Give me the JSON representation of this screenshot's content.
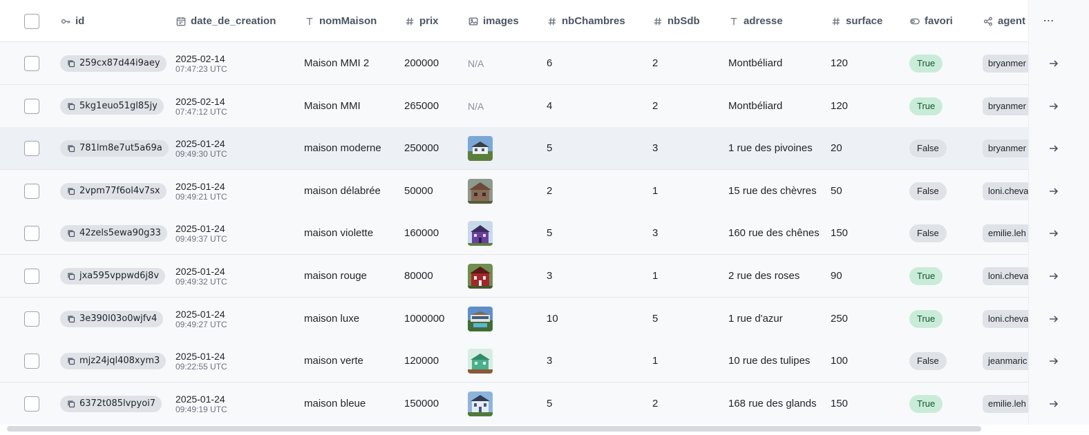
{
  "columns": {
    "id": "id",
    "date_de_creation": "date_de_creation",
    "nomMaison": "nomMaison",
    "prix": "prix",
    "images": "images",
    "nbChambres": "nbChambres",
    "nbSdb": "nbSdb",
    "adresse": "adresse",
    "surface": "surface",
    "favori": "favori",
    "agent": "agent",
    "more": "⋯"
  },
  "icons": {
    "id": "key-icon",
    "date_de_creation": "calendar-icon",
    "nomMaison": "text-icon",
    "prix": "hash-icon",
    "images": "image-icon",
    "nbChambres": "hash-icon",
    "nbSdb": "hash-icon",
    "adresse": "text-icon",
    "surface": "hash-icon",
    "favori": "toggle-icon",
    "agent": "relation-icon"
  },
  "colors": {
    "true_badge_bg": "#c9ecd8",
    "false_badge_bg": "#dfe2e7",
    "pill_bg": "#dfe2e7",
    "row_hover_bg": "#edf0f4"
  },
  "rows": [
    {
      "id": "259cx87d44i9aey",
      "date": "2025-02-14",
      "time": "07:47:23 UTC",
      "nomMaison": "Maison MMI 2",
      "prix": "200000",
      "image": "N/A",
      "nbChambres": "6",
      "nbSdb": "2",
      "adresse": "Montbéliard",
      "surface": "120",
      "favori": "True",
      "agent": "bryanmer"
    },
    {
      "id": "5kg1euo51gl85jy",
      "date": "2025-02-14",
      "time": "07:47:12 UTC",
      "nomMaison": "Maison MMI",
      "prix": "265000",
      "image": "N/A",
      "nbChambres": "4",
      "nbSdb": "2",
      "adresse": "Montbéliard",
      "surface": "120",
      "favori": "True",
      "agent": "bryanmer"
    },
    {
      "id": "781lm8e7ut5a69a",
      "date": "2025-01-24",
      "time": "09:49:30 UTC",
      "nomMaison": "maison moderne",
      "prix": "250000",
      "image": "white-house",
      "nbChambres": "5",
      "nbSdb": "3",
      "adresse": "1 rue des pivoines",
      "surface": "20",
      "favori": "False",
      "agent": "bryanmer"
    },
    {
      "id": "2vpm77f6ol4v7sx",
      "date": "2025-01-24",
      "time": "09:49:21 UTC",
      "nomMaison": "maison délabrée",
      "prix": "50000",
      "image": "old-house",
      "nbChambres": "2",
      "nbSdb": "1",
      "adresse": "15 rue des chèvres",
      "surface": "50",
      "favori": "False",
      "agent": "loni.cheva"
    },
    {
      "id": "42zels5ewa90g33",
      "date": "2025-01-24",
      "time": "09:49:37 UTC",
      "nomMaison": "maison violette",
      "prix": "160000",
      "image": "purple-house",
      "nbChambres": "5",
      "nbSdb": "3",
      "adresse": "160 rue des chênes",
      "surface": "150",
      "favori": "False",
      "agent": "emilie.leh"
    },
    {
      "id": "jxa595vppwd6j8v",
      "date": "2025-01-24",
      "time": "09:49:32 UTC",
      "nomMaison": "maison rouge",
      "prix": "80000",
      "image": "red-house",
      "nbChambres": "3",
      "nbSdb": "1",
      "adresse": "2 rue des roses",
      "surface": "90",
      "favori": "True",
      "agent": "loni.cheva"
    },
    {
      "id": "3e390l03o0wjfv4",
      "date": "2025-01-24",
      "time": "09:49:27 UTC",
      "nomMaison": "maison luxe",
      "prix": "1000000",
      "image": "luxury-house",
      "nbChambres": "10",
      "nbSdb": "5",
      "adresse": "1 rue d'azur",
      "surface": "250",
      "favori": "True",
      "agent": "loni.cheva"
    },
    {
      "id": "mjz24jql408xym3",
      "date": "2025-01-24",
      "time": "09:22:55 UTC",
      "nomMaison": "maison verte",
      "prix": "120000",
      "image": "green-house",
      "nbChambres": "3",
      "nbSdb": "1",
      "adresse": "10 rue des tulipes",
      "surface": "100",
      "favori": "False",
      "agent": "jeanmaric"
    },
    {
      "id": "6372t085lvpyoi7",
      "date": "2025-01-24",
      "time": "09:49:19 UTC",
      "nomMaison": "maison bleue",
      "prix": "150000",
      "image": "blue-house",
      "nbChambres": "5",
      "nbSdb": "2",
      "adresse": "168 rue des glands",
      "surface": "150",
      "favori": "True",
      "agent": "emilie.leh"
    }
  ]
}
